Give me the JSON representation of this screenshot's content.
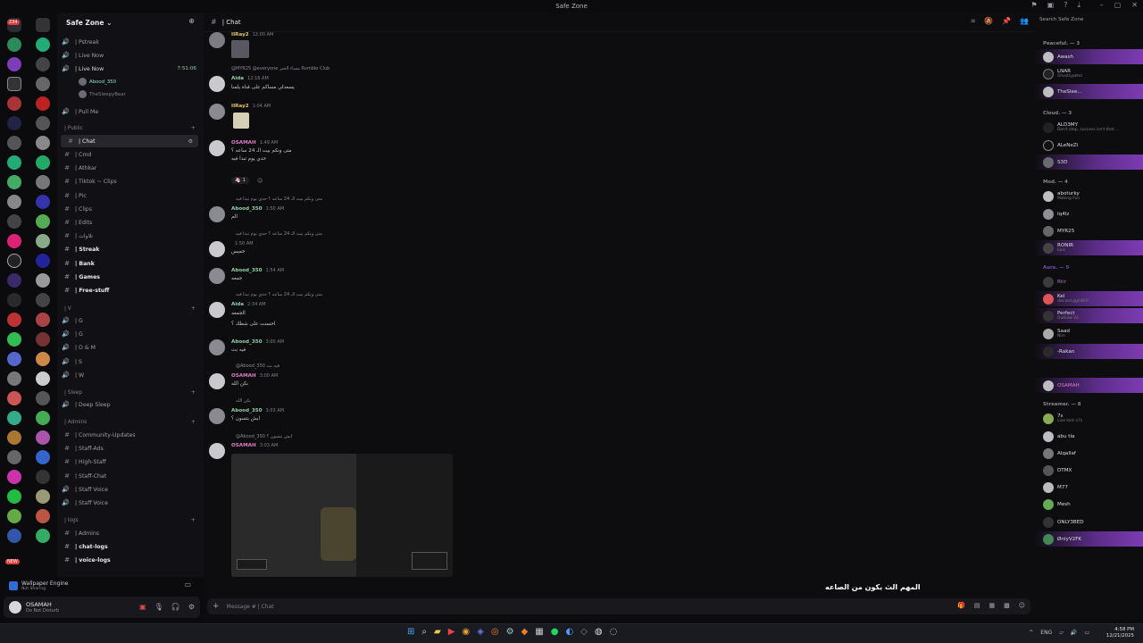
{
  "window": {
    "title": "Safe Zone"
  },
  "server": {
    "name": "Safe Zone",
    "timer": "7:51:06"
  },
  "channels": [
    {
      "label": "| Pstreak",
      "type": "voice"
    },
    {
      "label": "| Live Now",
      "type": "voice"
    },
    {
      "label": "| Live Now",
      "type": "voice"
    },
    {
      "label": "| Pull Me",
      "type": "voice"
    }
  ],
  "voice_users": [
    "Abood_350",
    "TheSleepyBear"
  ],
  "categories": {
    "public": "| Public",
    "v": "| V",
    "sleep": "| Sleep",
    "admins": "| Admins",
    "logs": "| logs"
  },
  "public_channels": [
    "| Chat",
    "| Cmd",
    "| Athkar",
    "| Tiktok ~ Clips",
    "| Pic",
    "| Clips",
    "| Edits",
    "| تلاوات",
    "| Streak",
    "| Bank",
    "| Games",
    "| Free-stuff"
  ],
  "v_channels": [
    "| G",
    "| G",
    "| O & M",
    "| S",
    "| W"
  ],
  "sleep_channels": [
    "| Deep Sleep"
  ],
  "admin_channels": [
    "| Community-Updates",
    "| Staff-Ads",
    "| High-Staff",
    "| Staff-Chat",
    "| Staff Voice",
    "| Staff Voice"
  ],
  "log_channels": [
    "| Admins",
    "| chat-logs",
    "| voice-logs"
  ],
  "wallpaper_engine": {
    "title": "Wallpaper Engine",
    "status": "Not Sharing"
  },
  "user": {
    "name": "OSAMAH",
    "status": "Do Not Disturb"
  },
  "chat": {
    "channel": "| Chat",
    "composer_placeholder": "Message # | Chat",
    "overlay_caption": "المهم الث يكون من الصاعه",
    "messages": [
      {
        "author": "IIRay2",
        "time": "12:00 AM",
        "body": ""
      },
      {
        "author": "Aida",
        "time": "12:16 AM",
        "reply": "@MYR25 @everyone مساء الخير Rumble Club",
        "body": "يسعدلي مساكم على قناة يلمنا"
      },
      {
        "author": "IIRay2",
        "time": "1:04 AM",
        "body": ""
      },
      {
        "author": "OSAMAH",
        "time": "1:49 AM",
        "body": "متى ونكم بيت الـ 24 ساعه ؟",
        "body2": "حدي يوم تبدا فيه",
        "reaction_count": "1"
      },
      {
        "author": "Abood_350",
        "time": "1:50 AM",
        "reply": "متى ونكم بيت الـ 24 ساعه ؟ حدي يوم تبدا فيه",
        "body": "الم"
      },
      {
        "author": "",
        "time": "1:50 AM",
        "reply": "متى ونكم بيت الـ 24 ساعه ؟ حدي يوم تبدا فيه",
        "body": "خميس"
      },
      {
        "author": "Abood_350",
        "time": "1:54 AM",
        "body": "جمعه"
      },
      {
        "author": "Aida",
        "time": "2:34 AM",
        "reply": "متى ونكم بيت الـ 24 ساعه ؟ حدي يوم تبدا فيه",
        "body": "الجمعه",
        "body2": "احسنت على شطك ؟"
      },
      {
        "author": "Abood_350",
        "time": "3:00 AM",
        "body": "فيه بث"
      },
      {
        "author": "OSAMAH",
        "time": "3:00 AM",
        "reply": "@Abood_350 فيه بث",
        "body": "بكن الله"
      },
      {
        "author": "Abood_350",
        "time": "3:03 AM",
        "reply": "بكن الله",
        "body": "ايش بتسون ؟"
      },
      {
        "author": "OSAMAH",
        "time": "3:03 AM",
        "reply": "@Abood_350 ايش بتسون ؟",
        "body": ""
      }
    ]
  },
  "members": {
    "search_placeholder": "Search Safe Zone",
    "groups": [
      {
        "name": "Peaceful. — 3",
        "items": [
          {
            "name": "Awash",
            "sub": ""
          },
          {
            "name": "LNAR",
            "sub": "Ghostlypetal"
          },
          {
            "name": "TheSlee...",
            "sub": ""
          }
        ]
      },
      {
        "name": "Cloud. — 3",
        "items": [
          {
            "name": "ALD3MY",
            "sub": "Don't stop, success isn't that ..."
          },
          {
            "name": "ALeNeZi",
            "sub": ""
          },
          {
            "name": "S3D",
            "sub": ""
          }
        ]
      },
      {
        "name": "Mod. — 4",
        "items": [
          {
            "name": "aboturky",
            "sub": "Making Fun"
          },
          {
            "name": "Iq4lz",
            "sub": ""
          },
          {
            "name": "MYR25",
            "sub": ""
          },
          {
            "name": "RONIR",
            "sub": "Epic"
          }
        ]
      },
      {
        "name": "Aura. — 5",
        "items": [
          {
            "name": "Rtir",
            "sub": ""
          },
          {
            "name": "Kel",
            "sub": "discord.gg/i4UU"
          },
          {
            "name": "Perfect",
            "sub": "OutLaw V2"
          },
          {
            "name": "Saad",
            "sub": "Nim"
          },
          {
            "name": "-Rakan",
            "sub": ""
          }
        ]
      },
      {
        "name": "Streamer. — 8",
        "items": [
          {
            "name": "7s",
            "sub": "Live kick x7s"
          },
          {
            "name": "abu tla",
            "sub": ""
          },
          {
            "name": "Alqallaf",
            "sub": ""
          },
          {
            "name": "DTMX",
            "sub": ""
          },
          {
            "name": "M77",
            "sub": ""
          },
          {
            "name": "Mesh",
            "sub": ""
          },
          {
            "name": "ONLY3BED",
            "sub": ""
          },
          {
            "name": "ØnlyV2FK",
            "sub": ""
          }
        ]
      }
    ],
    "osamah": "OSAMAH"
  },
  "taskbar": {
    "lang": "ENG",
    "time": "4:58 PM",
    "date": "12/21/2025"
  }
}
